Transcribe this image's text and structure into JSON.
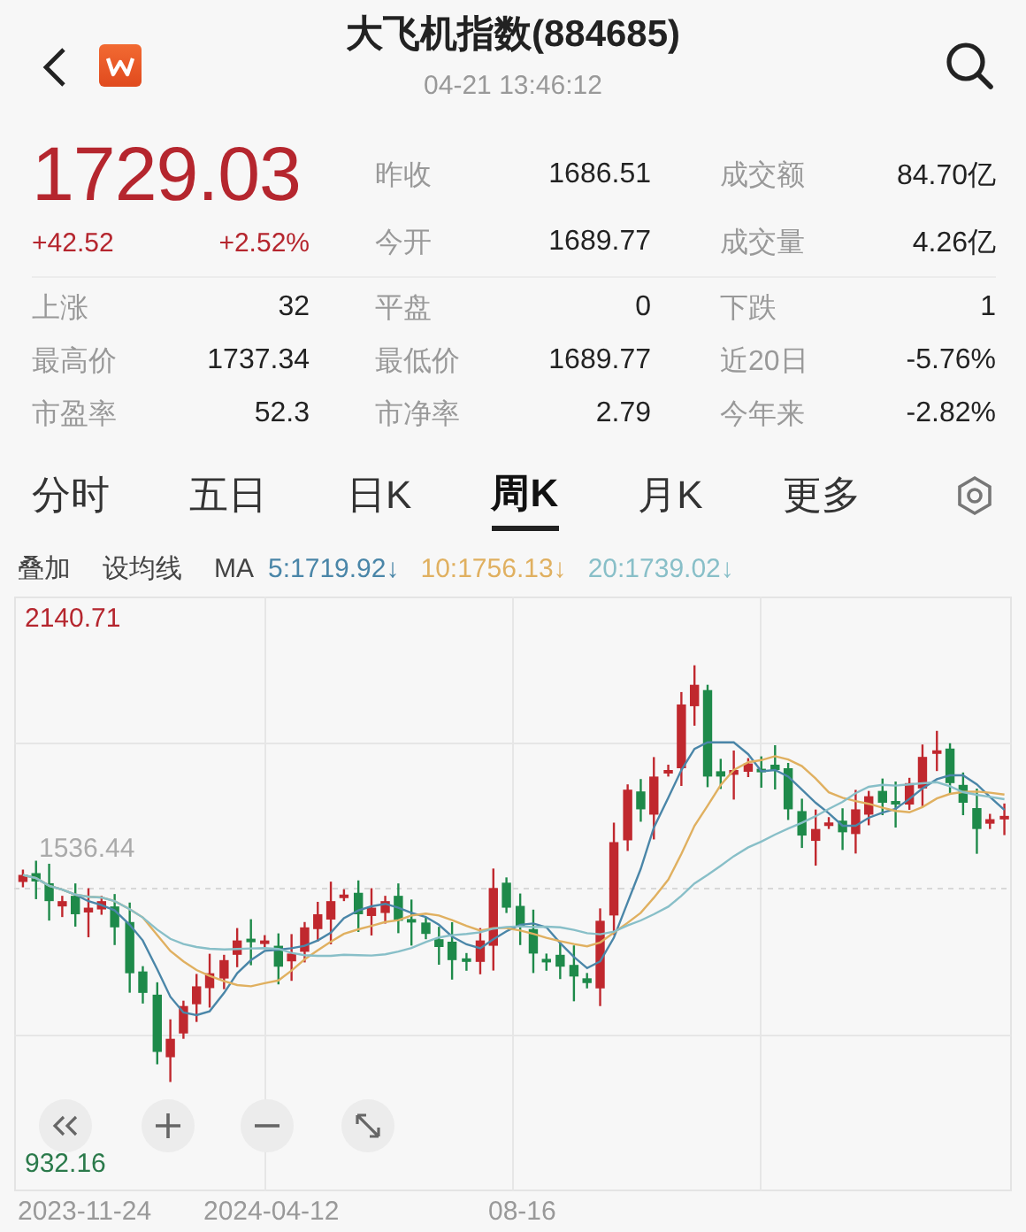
{
  "header": {
    "title": "大飞机指数(884685)",
    "time": "04-21 13:46:12"
  },
  "quote": {
    "price": "1729.03",
    "change": "+42.52",
    "change_pct": "+2.52%"
  },
  "stats_top": [
    [
      {
        "label": "昨收",
        "value": "1686.51"
      },
      {
        "label": "成交额",
        "value": "84.70亿"
      }
    ],
    [
      {
        "label": "今开",
        "value": "1689.77"
      },
      {
        "label": "成交量",
        "value": "4.26亿"
      }
    ]
  ],
  "stats": [
    [
      {
        "label": "上涨",
        "value": "32"
      },
      {
        "label": "平盘",
        "value": "0"
      },
      {
        "label": "下跌",
        "value": "1"
      }
    ],
    [
      {
        "label": "最高价",
        "value": "1737.34"
      },
      {
        "label": "最低价",
        "value": "1689.77"
      },
      {
        "label": "近20日",
        "value": "-5.76%"
      }
    ],
    [
      {
        "label": "市盈率",
        "value": "52.3"
      },
      {
        "label": "市净率",
        "value": "2.79"
      },
      {
        "label": "今年来",
        "value": "-2.82%"
      }
    ]
  ],
  "tabs": [
    {
      "label": "分时",
      "selected": false
    },
    {
      "label": "五日",
      "selected": false
    },
    {
      "label": "日K",
      "selected": false
    },
    {
      "label": "周K",
      "selected": true
    },
    {
      "label": "月K",
      "selected": false
    },
    {
      "label": "更多",
      "selected": false
    }
  ],
  "indicator_bar": {
    "overlay": "叠加",
    "ma_setting": "设均线",
    "ma_label": "MA",
    "ma_values": [
      {
        "text": "5:1719.92↓",
        "color": "#4a86a8"
      },
      {
        "text": "10:1756.13↓",
        "color": "#e0b060"
      },
      {
        "text": "20:1739.02↓",
        "color": "#88bfc8"
      }
    ]
  },
  "chart": {
    "y_max": "2140.71",
    "y_mid": "1536.44",
    "y_min": "932.16",
    "dates": [
      "2023-11-24",
      "2024-04-12",
      "08-16"
    ]
  }
}
